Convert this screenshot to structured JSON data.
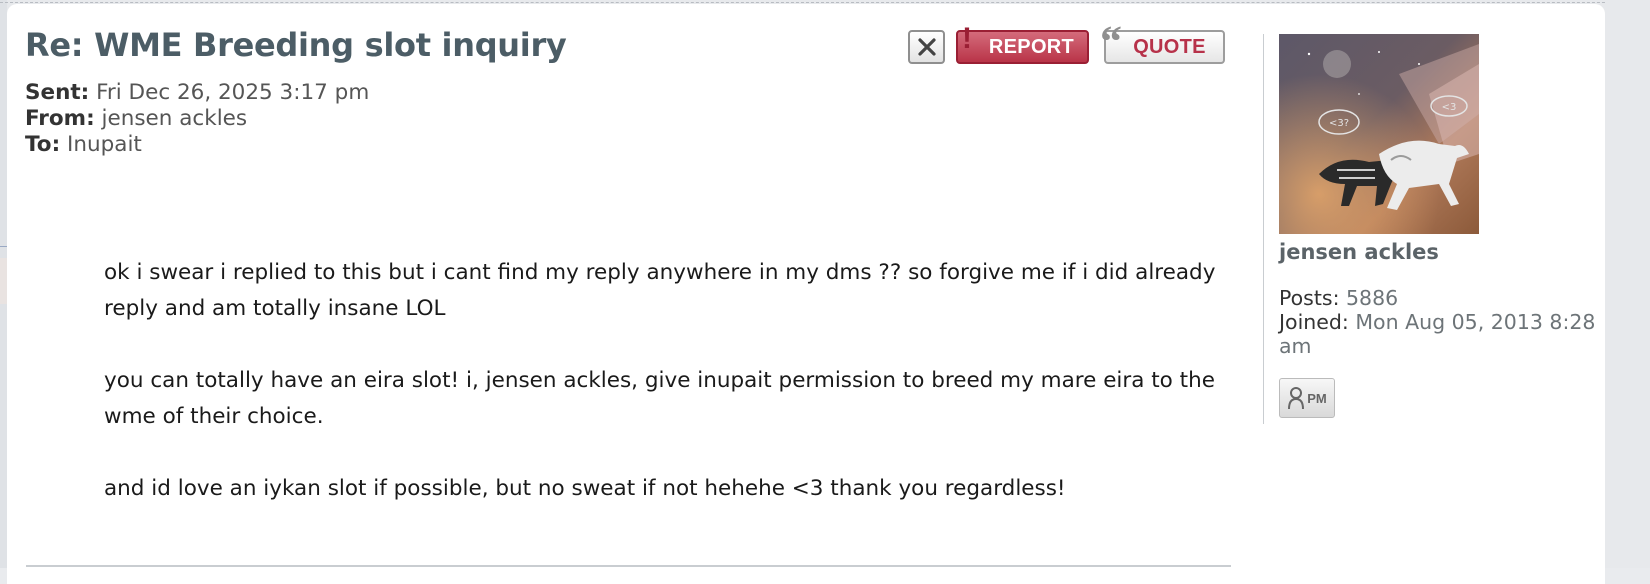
{
  "post": {
    "title": "Re: WME Breeding slot inquiry",
    "sent_label": "Sent:",
    "sent_value": "Fri Dec 26, 2025 3:17 pm",
    "from_label": "From:",
    "from_value": "jensen ackles",
    "to_label": "To:",
    "to_value": "Inupait"
  },
  "buttons": {
    "report_label": "REPORT",
    "quote_label": "QUOTE",
    "pm_label": "PM"
  },
  "body": {
    "paragraphs": [
      "ok i swear i replied to this but i cant find my reply anywhere in my dms ?? so forgive me if i did already reply and am totally insane LOL",
      "you can totally have an eira slot! i, jensen ackles, give inupait permission to breed my mare eira to the wme of their choice.",
      "and id love an iykan slot if possible, but no sweat if not hehehe <3 thank you regardless!"
    ]
  },
  "profile": {
    "username": "jensen ackles",
    "posts_label": "Posts:",
    "posts_value": "5886",
    "joined_label": "Joined:",
    "joined_value": "Mon Aug 05, 2013 8:28 am",
    "avatar_speech_1": "<3?",
    "avatar_speech_2": "<3"
  },
  "colors": {
    "title": "#4c5d66",
    "report_bg": "#b93448",
    "quote_text": "#b7324a"
  }
}
